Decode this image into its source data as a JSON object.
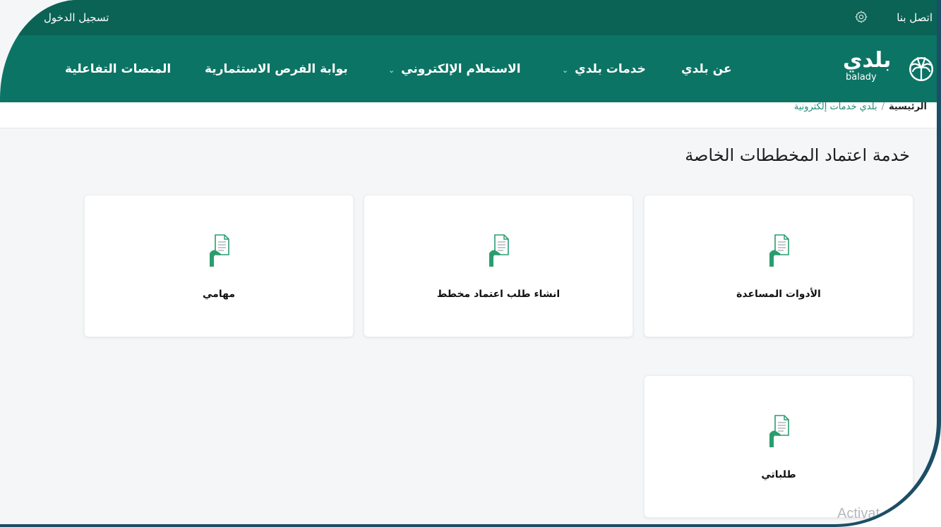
{
  "topbar": {
    "login_label": "تسجيل الدخول",
    "contact_label": "اتصل بنا",
    "settings_icon": "gear-icon"
  },
  "nav": {
    "items": [
      {
        "label": "عن بلدي"
      },
      {
        "label": "خدمات بلدي"
      },
      {
        "label": "الاستعلام الإلكتروني"
      },
      {
        "label": "بوابة الفرص الاستثمارية"
      },
      {
        "label": "المنصات التفاعلية"
      }
    ],
    "logo": {
      "arabic": "بلدي",
      "latin": "balady"
    }
  },
  "breadcrumb": {
    "home": "الرئيسية",
    "separator": "/",
    "current": "بلدي خدمات إلكترونية"
  },
  "page": {
    "title": "خدمة اعتماد المخططات الخاصة"
  },
  "cards": [
    {
      "label": "الأدوات المساعدة",
      "icon": "document-hand-icon"
    },
    {
      "label": "انشاء طلب اعتماد مخطط",
      "icon": "document-hand-icon"
    },
    {
      "label": "مهامي",
      "icon": "document-hand-icon"
    },
    {
      "label": "طلباتي",
      "icon": "document-hand-icon"
    }
  ],
  "watermark": "Activat",
  "colors": {
    "brand": "#0c7465",
    "brand_dark": "#0a6355",
    "accent_green": "#2a9d6f"
  }
}
